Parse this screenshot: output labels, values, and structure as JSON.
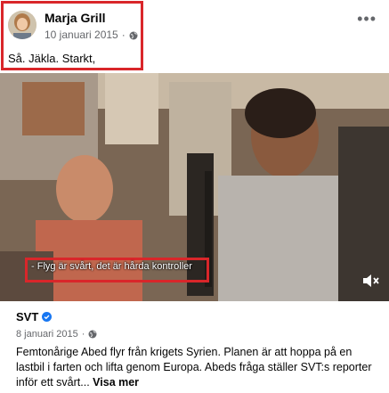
{
  "post": {
    "author": "Marja Grill",
    "date": "10 januari 2015",
    "privacy_icon": "globe-icon",
    "text": "Så. Jäkla. Starkt,",
    "more_icon": "more-horizontal-icon"
  },
  "video": {
    "subtitle": "- Flyg är svårt, det är hårda kontroller",
    "volume_icon": "volume-muted-icon"
  },
  "shared": {
    "source": "SVT",
    "verified_icon": "verified-badge-icon",
    "date": "8 januari 2015",
    "privacy_icon": "globe-icon",
    "body": "Femtonårige Abed flyr från krigets Syrien. Planen är att hoppa på en lastbil i farten och lifta genom Europa. Abeds fråga ställer SVT:s reporter inför ett svårt...",
    "see_more": "Visa mer"
  },
  "colors": {
    "highlight": "#d9262a",
    "verified": "#1877f2",
    "meta_text": "#65676b"
  }
}
